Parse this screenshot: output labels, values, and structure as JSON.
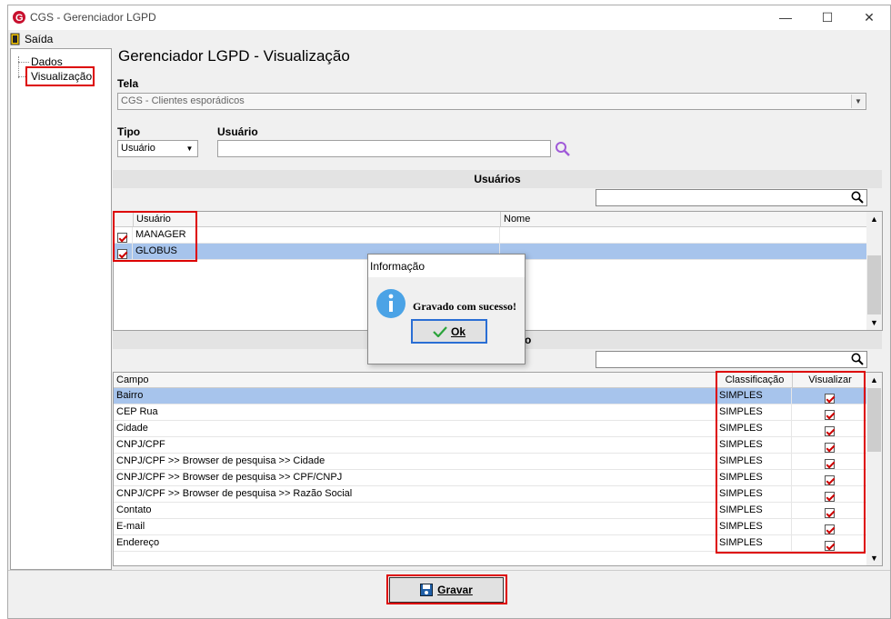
{
  "window": {
    "title": "CGS - Gerenciador LGPD",
    "minimize": "—",
    "maximize": "☐",
    "close": "✕"
  },
  "menu": {
    "exit_label": "Saída"
  },
  "tree": {
    "items": [
      {
        "label": "Dados"
      },
      {
        "label": "Visualização"
      }
    ]
  },
  "page": {
    "title": "Gerenciador LGPD - Visualização"
  },
  "form": {
    "tela_label": "Tela",
    "tela_value": "CGS - Clientes esporádicos",
    "tipo_label": "Tipo",
    "tipo_value": "Usuário",
    "usuario_label": "Usuário",
    "usuario_value": ""
  },
  "users_section": {
    "title": "Usuários",
    "columns": [
      "Usuário",
      "Nome"
    ],
    "rows": [
      {
        "user": "MANAGER",
        "name": "",
        "checked": true
      },
      {
        "user": "GLOBUS",
        "name": "",
        "checked": true
      }
    ]
  },
  "fields_section": {
    "title_partial": "o",
    "columns": [
      "Campo",
      "Classificação",
      "Visualizar"
    ],
    "rows": [
      {
        "campo": "Bairro",
        "class": "SIMPLES"
      },
      {
        "campo": "CEP Rua",
        "class": "SIMPLES"
      },
      {
        "campo": "Cidade",
        "class": "SIMPLES"
      },
      {
        "campo": "CNPJ/CPF",
        "class": "SIMPLES"
      },
      {
        "campo": "CNPJ/CPF >> Browser de pesquisa >> Cidade",
        "class": "SIMPLES"
      },
      {
        "campo": "CNPJ/CPF >> Browser de pesquisa >> CPF/CNPJ",
        "class": "SIMPLES"
      },
      {
        "campo": "CNPJ/CPF >> Browser de pesquisa >> Razão Social",
        "class": "SIMPLES"
      },
      {
        "campo": "Contato",
        "class": "SIMPLES"
      },
      {
        "campo": "E-mail",
        "class": "SIMPLES"
      },
      {
        "campo": "Endereço",
        "class": "SIMPLES"
      }
    ]
  },
  "dialog": {
    "title": "Informação",
    "message": "Gravado com sucesso!",
    "ok_label": "Ok"
  },
  "footer": {
    "save_label": "Gravar"
  },
  "colors": {
    "selection": "#a7c4ec",
    "highlight_red": "#dd0000",
    "info_blue": "#4ba3e6"
  }
}
